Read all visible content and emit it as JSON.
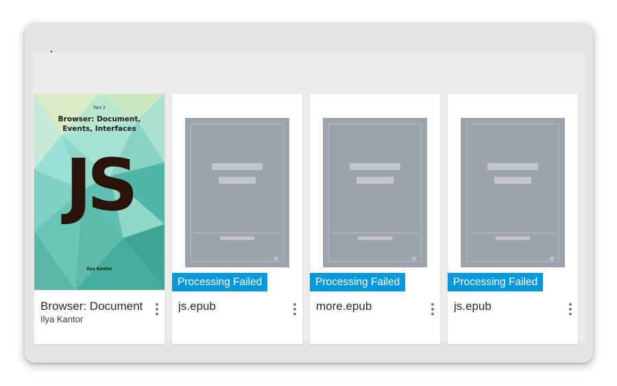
{
  "library": {
    "books": [
      {
        "title": "Browser: Document, Events, Interfaces",
        "author": "Ilya Kantor",
        "has_cover": true,
        "cover": {
          "part": "Part 2",
          "title_line1": "Browser: Document,",
          "title_line2": "Events, Interfaces",
          "logo_text": "JS",
          "author": "Ilya Kantor"
        }
      },
      {
        "title": "js.epub",
        "author": "",
        "has_cover": false,
        "status": "Processing Failed"
      },
      {
        "title": "more.epub",
        "author": "",
        "has_cover": false,
        "status": "Processing Failed"
      },
      {
        "title": "js.epub",
        "author": "",
        "has_cover": false,
        "status": "Processing Failed"
      }
    ]
  },
  "colors": {
    "status_badge": "#0a98dd",
    "placeholder_cover": "#9da3aa",
    "background": "#e4e4e4"
  },
  "icons": {
    "card_menu": "more-vertical-icon"
  }
}
